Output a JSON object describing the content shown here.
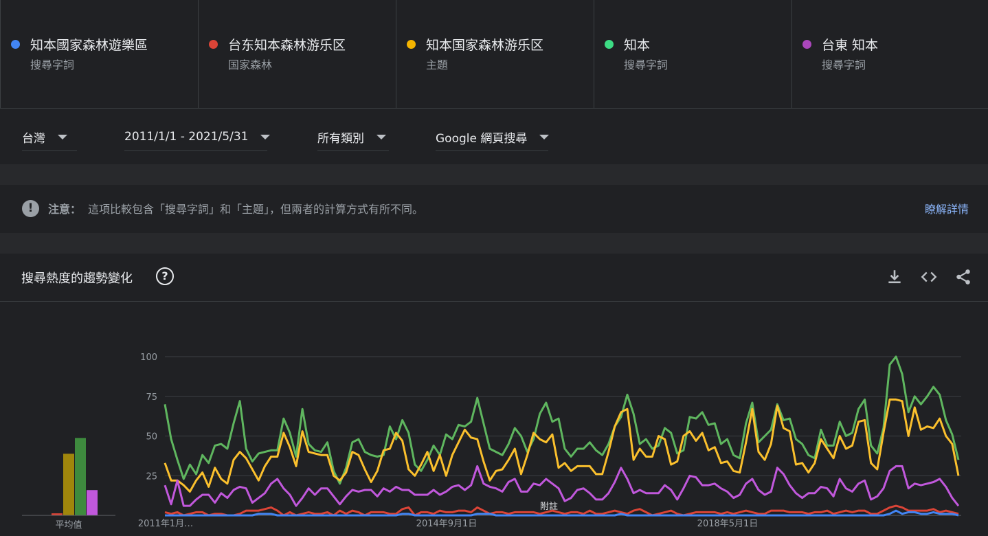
{
  "terms": [
    {
      "name": "知本國家森林遊樂區",
      "type": "搜尋字詞",
      "color": "#4285f4"
    },
    {
      "name": "台东知本森林游乐区",
      "type": "国家森林",
      "color": "#db4437"
    },
    {
      "name": "知本国家森林游乐区",
      "type": "主題",
      "color": "#f4b400"
    },
    {
      "name": "知本",
      "type": "搜尋字詞",
      "color": "#3ddc84"
    },
    {
      "name": "台東 知本",
      "type": "搜尋字詞",
      "color": "#ab47bc"
    }
  ],
  "filters": {
    "region": "台灣",
    "date_range": "2011/1/1 - 2021/5/31",
    "category": "所有類別",
    "property": "Google 網頁搜尋"
  },
  "notice": {
    "label": "注意：",
    "text": "這項比較包含「搜尋字詞」和「主題」，但兩者的計算方式有所不同。",
    "link": "瞭解詳情"
  },
  "chart_section": {
    "title": "搜尋熱度的趨勢變化",
    "help_icon": "question-circle-icon",
    "download_icon": "download-icon",
    "embed_icon": "code-icon",
    "share_icon": "share-icon",
    "footnote": "附註",
    "avg_label": "平均值"
  },
  "chart_data": {
    "type": "line",
    "ylim": [
      0,
      100
    ],
    "yticks": [
      25,
      50,
      75,
      100
    ],
    "x_start": "2011年1月",
    "x_end": "2021年5月",
    "x_tick_labels": [
      "2011年1月…",
      "2014年9月1日",
      "2018年5月1日"
    ],
    "grid": true,
    "series": [
      {
        "name": "知本",
        "color": "#5fb65f",
        "values": [
          70,
          48,
          35,
          23,
          32,
          26,
          38,
          33,
          44,
          45,
          42,
          58,
          72,
          42,
          34,
          39,
          40,
          41,
          41,
          61,
          52,
          37,
          67,
          45,
          41,
          40,
          46,
          28,
          20,
          30,
          46,
          48,
          40,
          38,
          37,
          38,
          56,
          48,
          60,
          52,
          32,
          28,
          35,
          44,
          38,
          51,
          48,
          57,
          56,
          59,
          74,
          58,
          42,
          40,
          38,
          45,
          55,
          50,
          40,
          48,
          64,
          71,
          59,
          61,
          42,
          37,
          42,
          42,
          46,
          41,
          38,
          45,
          56,
          62,
          76,
          64,
          45,
          48,
          42,
          44,
          55,
          52,
          39,
          41,
          62,
          61,
          65,
          57,
          58,
          45,
          48,
          38,
          36,
          58,
          71,
          46,
          50,
          54,
          70,
          60,
          61,
          48,
          45,
          38,
          36,
          54,
          44,
          44,
          59,
          50,
          52,
          67,
          73,
          44,
          39,
          55,
          95,
          100,
          89,
          65,
          75,
          70,
          75,
          81,
          76,
          60,
          51,
          35
        ]
      },
      {
        "name": "知本国家森林游乐区",
        "color": "#fbc02d",
        "values": [
          33,
          22,
          22,
          19,
          15,
          22,
          27,
          18,
          30,
          23,
          20,
          35,
          40,
          36,
          29,
          22,
          31,
          37,
          37,
          52,
          43,
          31,
          53,
          40,
          39,
          38,
          38,
          25,
          22,
          27,
          40,
          38,
          29,
          21,
          28,
          41,
          42,
          52,
          47,
          29,
          25,
          32,
          40,
          28,
          38,
          25,
          38,
          46,
          54,
          49,
          48,
          34,
          22,
          28,
          29,
          35,
          42,
          26,
          38,
          52,
          48,
          46,
          51,
          30,
          33,
          28,
          31,
          31,
          31,
          26,
          26,
          40,
          56,
          65,
          67,
          35,
          42,
          37,
          37,
          50,
          48,
          32,
          34,
          50,
          53,
          47,
          52,
          41,
          43,
          33,
          34,
          28,
          27,
          46,
          67,
          40,
          35,
          45,
          69,
          55,
          53,
          32,
          33,
          27,
          33,
          48,
          42,
          36,
          50,
          42,
          44,
          59,
          60,
          33,
          29,
          52,
          73,
          73,
          72,
          50,
          68,
          54,
          56,
          55,
          61,
          50,
          45,
          25
        ]
      },
      {
        "name": "台東 知本",
        "color": "#c158dc",
        "values": [
          19,
          7,
          22,
          6,
          6,
          10,
          13,
          13,
          8,
          14,
          11,
          16,
          18,
          17,
          8,
          11,
          14,
          20,
          23,
          17,
          13,
          6,
          11,
          17,
          13,
          17,
          17,
          12,
          7,
          12,
          16,
          15,
          16,
          16,
          12,
          17,
          15,
          18,
          16,
          16,
          13,
          13,
          13,
          16,
          13,
          15,
          18,
          19,
          16,
          19,
          31,
          20,
          18,
          17,
          15,
          21,
          23,
          15,
          15,
          20,
          19,
          23,
          20,
          17,
          9,
          11,
          16,
          17,
          14,
          10,
          10,
          14,
          21,
          30,
          23,
          14,
          16,
          14,
          14,
          14,
          19,
          16,
          10,
          17,
          25,
          24,
          19,
          19,
          20,
          17,
          15,
          11,
          13,
          20,
          23,
          16,
          13,
          15,
          30,
          26,
          19,
          14,
          11,
          14,
          14,
          18,
          17,
          12,
          23,
          17,
          15,
          20,
          22,
          10,
          12,
          17,
          28,
          31,
          31,
          17,
          20,
          19,
          20,
          21,
          23,
          18,
          11,
          6
        ]
      },
      {
        "name": "台东知本森林游乐区",
        "color": "#db4437",
        "values": [
          2,
          1,
          2,
          0,
          1,
          2,
          2,
          0,
          1,
          1,
          0,
          0,
          1,
          3,
          3,
          3,
          4,
          5,
          3,
          0,
          2,
          0,
          1,
          2,
          1,
          1,
          2,
          0,
          3,
          1,
          3,
          2,
          0,
          2,
          2,
          2,
          1,
          1,
          4,
          5,
          0,
          2,
          2,
          1,
          3,
          2,
          2,
          3,
          3,
          2,
          5,
          3,
          1,
          2,
          2,
          1,
          2,
          2,
          2,
          2,
          1,
          2,
          3,
          2,
          1,
          2,
          2,
          1,
          3,
          1,
          1,
          2,
          3,
          2,
          1,
          3,
          4,
          2,
          0,
          1,
          2,
          3,
          1,
          0,
          1,
          2,
          2,
          2,
          2,
          1,
          2,
          1,
          2,
          3,
          2,
          1,
          1,
          3,
          3,
          3,
          2,
          2,
          2,
          1,
          2,
          2,
          3,
          1,
          2,
          3,
          2,
          3,
          3,
          1,
          1,
          3,
          5,
          6,
          5,
          3,
          3,
          3,
          3,
          4,
          2,
          3,
          2,
          1
        ]
      },
      {
        "name": "知本國家森林遊樂區",
        "color": "#4285f4",
        "values": [
          0,
          0,
          0,
          0,
          0,
          0,
          0,
          0,
          0,
          0,
          0,
          0,
          0,
          0,
          0,
          1,
          1,
          1,
          0,
          0,
          0,
          0,
          0,
          0,
          0,
          0,
          0,
          0,
          0,
          0,
          0,
          0,
          0,
          0,
          0,
          0,
          0,
          0,
          1,
          1,
          0,
          0,
          0,
          0,
          0,
          0,
          0,
          0,
          0,
          0,
          1,
          1,
          1,
          0,
          0,
          0,
          0,
          0,
          0,
          0,
          0,
          0,
          0,
          0,
          0,
          0,
          0,
          0,
          0,
          0,
          0,
          0,
          0,
          1,
          0,
          0,
          0,
          0,
          0,
          0,
          0,
          0,
          0,
          0,
          0,
          0,
          0,
          0,
          0,
          0,
          0,
          0,
          0,
          0,
          0,
          0,
          0,
          0,
          0,
          0,
          0,
          0,
          0,
          0,
          0,
          0,
          0,
          0,
          0,
          0,
          0,
          0,
          0,
          0,
          0,
          0,
          1,
          3,
          1,
          2,
          2,
          1,
          1,
          2,
          1,
          1,
          1,
          0
        ]
      }
    ],
    "averages": [
      {
        "name": "知本國家森林遊樂區",
        "color": "#4285f4",
        "value": 0
      },
      {
        "name": "台东知本森林游乐区",
        "color": "#db4437",
        "value": 1
      },
      {
        "name": "知本国家森林游乐区",
        "color": "#a0860c",
        "value": 39
      },
      {
        "name": "知本",
        "color": "#3e8a3e",
        "value": 49
      },
      {
        "name": "台東 知本",
        "color": "#c158dc",
        "value": 16
      }
    ]
  }
}
